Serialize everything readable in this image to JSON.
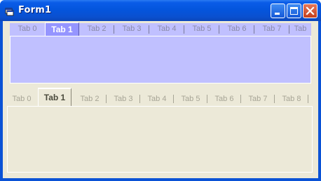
{
  "window": {
    "title": "Form1"
  },
  "title_buttons": {
    "minimize": "minimize",
    "maximize": "maximize",
    "close": "close"
  },
  "tabstrip_top": {
    "selected_index": 1,
    "tabs": [
      "Tab 0",
      "Tab 1",
      "Tab 2",
      "Tab 3",
      "Tab 4",
      "Tab 5",
      "Tab 6",
      "Tab 7",
      "Tab"
    ],
    "color": "#c0c0ff",
    "selected_color": "#9595ff"
  },
  "tabstrip_bottom": {
    "selected_index": 1,
    "tabs": [
      "Tab 0",
      "Tab 1",
      "Tab 2",
      "Tab 3",
      "Tab 4",
      "Tab 5",
      "Tab 6",
      "Tab 7",
      "Tab 8"
    ],
    "color": "#ece9d8"
  },
  "icons": {
    "app": "form-icon",
    "minimize": "minimize-icon",
    "maximize": "maximize-icon",
    "close": "close-icon"
  }
}
